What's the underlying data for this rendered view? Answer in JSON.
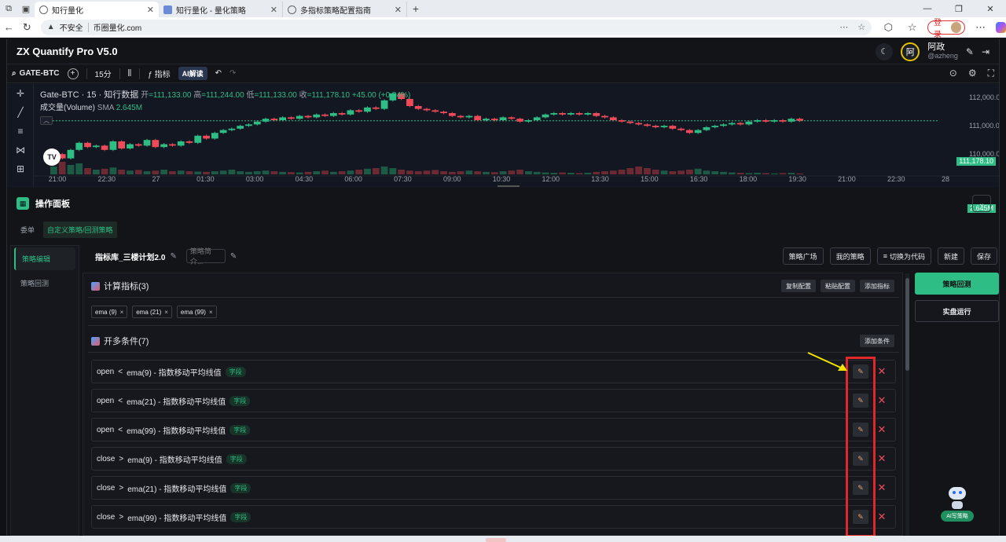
{
  "browser": {
    "tabs": [
      {
        "label": "知行量化",
        "active": true
      },
      {
        "label": "知行量化 - 量化策略",
        "active": false
      },
      {
        "label": "多指标策略配置指南",
        "active": false
      }
    ],
    "insecure_label": "不安全",
    "url": "币圈量化.com",
    "login_label": "登录"
  },
  "app": {
    "title": "ZX Quantify Pro V5.0",
    "user": {
      "avatar_char": "阿",
      "name": "阿政",
      "handle": "@azheng"
    }
  },
  "toolbar": {
    "symbol": "GATE-BTC",
    "interval": "15分",
    "indicators_label": "指标",
    "ai_label": "AI解读"
  },
  "chart": {
    "legend_title": "Gate-BTC · 15 · 知行数据",
    "ohlc": {
      "open_label": "开",
      "open": "=111,133.00",
      "high_label": "高",
      "high": "=111,244.00",
      "low_label": "低",
      "low": "=111,133.00",
      "close_label": "收",
      "close": "=111,178.10",
      "change": "+45.00 (+0.04%)"
    },
    "volume_label": "成交量(Volume)",
    "sma_label": "SMA",
    "sma_value": "2.645M",
    "last_price": "111,178.10",
    "volume_tag": "2.645M",
    "logo_text": "TV"
  },
  "chart_data": {
    "type": "candlestick",
    "x_ticks": [
      "21:00",
      "22:30",
      "27",
      "01:30",
      "03:00",
      "04:30",
      "06:00",
      "07:30",
      "09:00",
      "10:30",
      "12:00",
      "13:30",
      "15:00",
      "16:30",
      "18:00",
      "19:30",
      "21:00",
      "22:30",
      "28"
    ],
    "y_ticks": [
      "112,000.00",
      "111,000.00",
      "110,000.00"
    ],
    "ylim": [
      109700,
      112200
    ],
    "last_value": 111178.1,
    "close": [
      110000,
      109850,
      110150,
      110400,
      110250,
      110300,
      110150,
      110450,
      110200,
      110350,
      110300,
      110500,
      110250,
      110350,
      110300,
      110450,
      110400,
      110650,
      110550,
      110750,
      110850,
      110900,
      111000,
      111050,
      111150,
      111250,
      111200,
      111300,
      111250,
      111350,
      111300,
      111400,
      111350,
      111450,
      111400,
      111550,
      111500,
      111650,
      111600,
      111900,
      112150,
      111950,
      111700,
      111600,
      111550,
      111500,
      111450,
      111350,
      111300,
      111350,
      111200,
      111250,
      111200,
      111300,
      111250,
      111150,
      111200,
      111300,
      111400,
      111450,
      111400,
      111450,
      111400,
      111450,
      111350,
      111300,
      111200,
      111150,
      111100,
      111050,
      111000,
      110950,
      111000,
      110900,
      110850,
      110750,
      110850,
      110950,
      111000,
      111050,
      111100,
      111050,
      111150,
      111200,
      111150,
      111200,
      111150,
      111250,
      111180
    ],
    "volume": [
      0.25,
      0.4,
      0.3,
      0.35,
      0.2,
      0.15,
      0.18,
      0.22,
      0.15,
      0.12,
      0.14,
      0.1,
      0.12,
      0.15,
      0.1,
      0.12,
      0.1,
      0.09,
      0.08,
      0.1,
      0.12,
      0.15,
      0.1,
      0.08,
      0.1,
      0.12,
      0.1,
      0.08,
      0.07,
      0.06,
      0.08,
      0.1,
      0.12,
      0.08,
      0.1,
      0.12,
      0.15,
      0.18,
      0.2,
      0.25,
      0.2,
      0.15,
      0.12,
      0.1,
      0.12,
      0.14,
      0.1,
      0.08,
      0.1,
      0.12,
      0.1,
      0.08,
      0.07,
      0.1,
      0.12,
      0.15,
      0.1,
      0.08,
      0.06,
      0.05,
      0.06,
      0.05,
      0.04,
      0.05,
      0.08,
      0.1,
      0.12,
      0.15,
      0.2,
      0.25,
      0.2,
      0.15,
      0.12,
      0.1,
      0.12,
      0.15,
      0.18,
      0.12,
      0.1,
      0.08,
      0.06,
      0.05,
      0.04,
      0.05,
      0.04,
      0.03,
      0.04,
      0.05,
      0.03
    ]
  },
  "panel": {
    "title": "操作面板",
    "sub_tabs": [
      "委单",
      "自定义策略/回测策略"
    ],
    "side_nav": [
      "策略编辑",
      "策略回测"
    ]
  },
  "strategy": {
    "name": "指标库_三楼计划2.0",
    "intro_placeholder": "策略简介...",
    "buttons": [
      "策略广场",
      "我的策略",
      "切换为代码",
      "新建",
      "保存"
    ]
  },
  "indicators_section": {
    "title": "计算指标(3)",
    "buttons": [
      "复制配置",
      "粘贴配置",
      "添加指标"
    ],
    "chips": [
      "ema (9)",
      "ema (21)",
      "ema (99)"
    ]
  },
  "long_section": {
    "title": "开多条件(7)",
    "add_label": "添加条件",
    "conditions": [
      {
        "left": "open",
        "op": "<",
        "right": "ema(9) - 指数移动平均线值",
        "tag": "字段"
      },
      {
        "left": "open",
        "op": "<",
        "right": "ema(21) - 指数移动平均线值",
        "tag": "字段"
      },
      {
        "left": "open",
        "op": "<",
        "right": "ema(99) - 指数移动平均线值",
        "tag": "字段"
      },
      {
        "left": "close",
        "op": ">",
        "right": "ema(9) - 指数移动平均线值",
        "tag": "字段"
      },
      {
        "left": "close",
        "op": ">",
        "right": "ema(21) - 指数移动平均线值",
        "tag": "字段"
      },
      {
        "left": "close",
        "op": ">",
        "right": "ema(99) - 指数移动平均线值",
        "tag": "字段"
      }
    ]
  },
  "right_actions": {
    "backtest": "策略回测",
    "live": "实盘运行"
  },
  "ai_helper": {
    "label": "AI写策略"
  },
  "colors": {
    "up": "#2ebd85",
    "down": "#ef4a5a",
    "annotation": "#e02828",
    "arrow": "#f2e600"
  }
}
